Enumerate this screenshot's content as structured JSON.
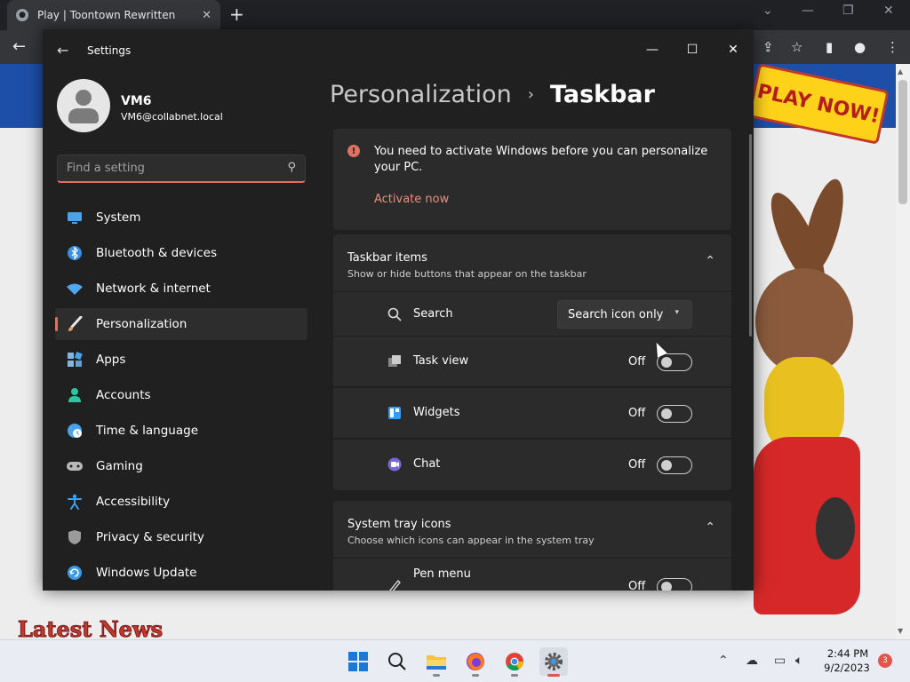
{
  "browser": {
    "tab_title": "Play | Toontown Rewritten",
    "tab_close": "✕",
    "new_tab": "+",
    "win_min": "—",
    "win_restore": "❐",
    "win_close": "✕",
    "dropdown": "⌄"
  },
  "webpage": {
    "banner_text": "PLAY NOW!",
    "latest_news": "Latest News"
  },
  "settings": {
    "app_title": "Settings",
    "back": "←",
    "minimize": "—",
    "maximize": "☐",
    "close": "✕",
    "profile": {
      "name": "VM6",
      "email": "VM6@collabnet.local"
    },
    "search": {
      "placeholder": "Find a setting"
    },
    "nav": [
      {
        "label": "System",
        "icon": "monitor-icon",
        "color": "#4aa3e8"
      },
      {
        "label": "Bluetooth & devices",
        "icon": "bluetooth-icon",
        "color": "#3a8fe0"
      },
      {
        "label": "Network & internet",
        "icon": "wifi-icon",
        "color": "#4fa8f0"
      },
      {
        "label": "Personalization",
        "icon": "brush-icon",
        "color": "#e8a070",
        "active": true
      },
      {
        "label": "Apps",
        "icon": "apps-icon",
        "color": "#8ab4e0"
      },
      {
        "label": "Accounts",
        "icon": "person-icon",
        "color": "#2ec4a0"
      },
      {
        "label": "Time & language",
        "icon": "globe-clock-icon",
        "color": "#4aa3e8"
      },
      {
        "label": "Gaming",
        "icon": "gamepad-icon",
        "color": "#b8b8b8"
      },
      {
        "label": "Accessibility",
        "icon": "accessibility-icon",
        "color": "#3ea0f0"
      },
      {
        "label": "Privacy & security",
        "icon": "shield-icon",
        "color": "#9a9a9a"
      },
      {
        "label": "Windows Update",
        "icon": "update-icon",
        "color": "#3a9be8"
      }
    ],
    "breadcrumb": {
      "parent": "Personalization",
      "separator": "›",
      "current": "Taskbar"
    },
    "activation": {
      "message": "You need to activate Windows before you can personalize your PC.",
      "link": "Activate now"
    },
    "taskbar_items": {
      "title": "Taskbar items",
      "subtitle": "Show or hide buttons that appear on the taskbar",
      "rows": [
        {
          "label": "Search",
          "value": "Search icon only"
        },
        {
          "label": "Task view",
          "state": "Off"
        },
        {
          "label": "Widgets",
          "state": "Off"
        },
        {
          "label": "Chat",
          "state": "Off"
        }
      ]
    },
    "system_tray": {
      "title": "System tray icons",
      "subtitle": "Choose which icons can appear in the system tray",
      "rows": [
        {
          "label": "Pen menu",
          "state": "Off"
        }
      ]
    }
  },
  "taskbar": {
    "time": "2:44 PM",
    "date": "9/2/2023",
    "notifications": "3"
  }
}
